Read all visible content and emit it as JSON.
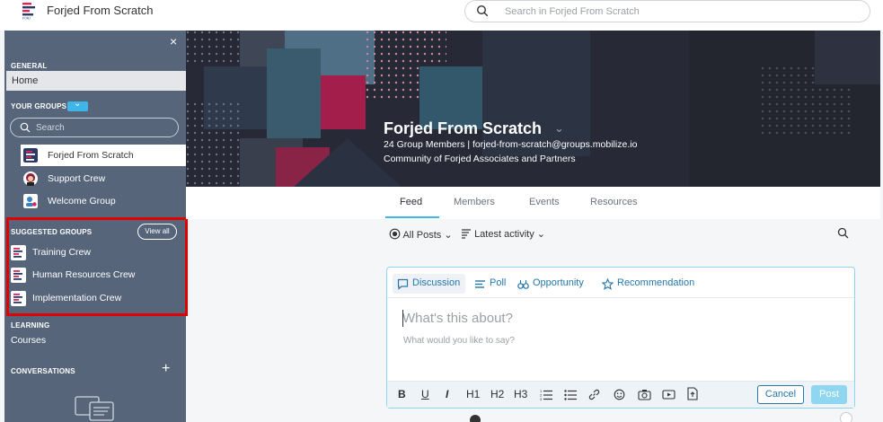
{
  "app": {
    "title": "Forjed From Scratch",
    "logo_icon": "forjed-logo-icon"
  },
  "search": {
    "placeholder": "Search in Forjed From Scratch",
    "icon": "search-icon"
  },
  "sidebar": {
    "close_icon": "close-icon",
    "close_label": "×",
    "general_label": "GENERAL",
    "home_label": "Home",
    "your_groups_label": "YOUR GROUPS",
    "groups_toggle_icon": "chevron-down-icon",
    "groups_toggle_glyph": "⌄",
    "search_placeholder": "Search",
    "groups": [
      {
        "label": "Forjed From Scratch",
        "icon": "forjed-logo-icon",
        "active": true
      },
      {
        "label": "Support Crew",
        "icon": "avatar-icon",
        "active": false
      },
      {
        "label": "Welcome Group",
        "icon": "person-icon",
        "active": false
      }
    ],
    "suggested_label": "SUGGESTED GROUPS",
    "view_all_label": "View all",
    "suggested": [
      {
        "label": "Training Crew",
        "icon": "forjed-logo-icon"
      },
      {
        "label": "Human Resources Crew",
        "icon": "forjed-logo-icon"
      },
      {
        "label": "Implementation Crew",
        "icon": "forjed-logo-icon"
      }
    ],
    "learning_label": "LEARNING",
    "courses_label": "Courses",
    "conversations_label": "CONVERSATIONS",
    "add_label": "+",
    "highlight_color": "#e00000"
  },
  "banner": {
    "title": "Forjed From Scratch",
    "chevron": "⌄",
    "line1": "24 Group Members | forjed-from-scratch@groups.mobilize.io",
    "line2": "Community of Forjed Associates and Partners"
  },
  "tabs": [
    {
      "label": "Feed",
      "active": true
    },
    {
      "label": "Members",
      "active": false
    },
    {
      "label": "Events",
      "active": false
    },
    {
      "label": "Resources",
      "active": false
    }
  ],
  "filters": {
    "all_posts": "All Posts",
    "latest": "Latest activity",
    "chevron": "⌄"
  },
  "composer": {
    "types": [
      {
        "label": "Discussion",
        "icon": "chat-bubble-icon",
        "active": true
      },
      {
        "label": "Poll",
        "icon": "poll-icon",
        "active": false
      },
      {
        "label": "Opportunity",
        "icon": "binoculars-icon",
        "active": false
      },
      {
        "label": "Recommendation",
        "icon": "star-icon",
        "active": false
      }
    ],
    "title_placeholder": "What's this about?",
    "body_placeholder": "What would you like to say?",
    "toolbar": {
      "bold": "B",
      "underline": "U",
      "italic": "I",
      "h1": "H1",
      "h2": "H2",
      "h3": "H3"
    },
    "cancel_label": "Cancel",
    "post_label": "Post"
  },
  "colors": {
    "accent": "#3fb6e8",
    "link": "#2477a8",
    "sidebar_bg": "#56657a",
    "banner_bg": "#272a36"
  }
}
